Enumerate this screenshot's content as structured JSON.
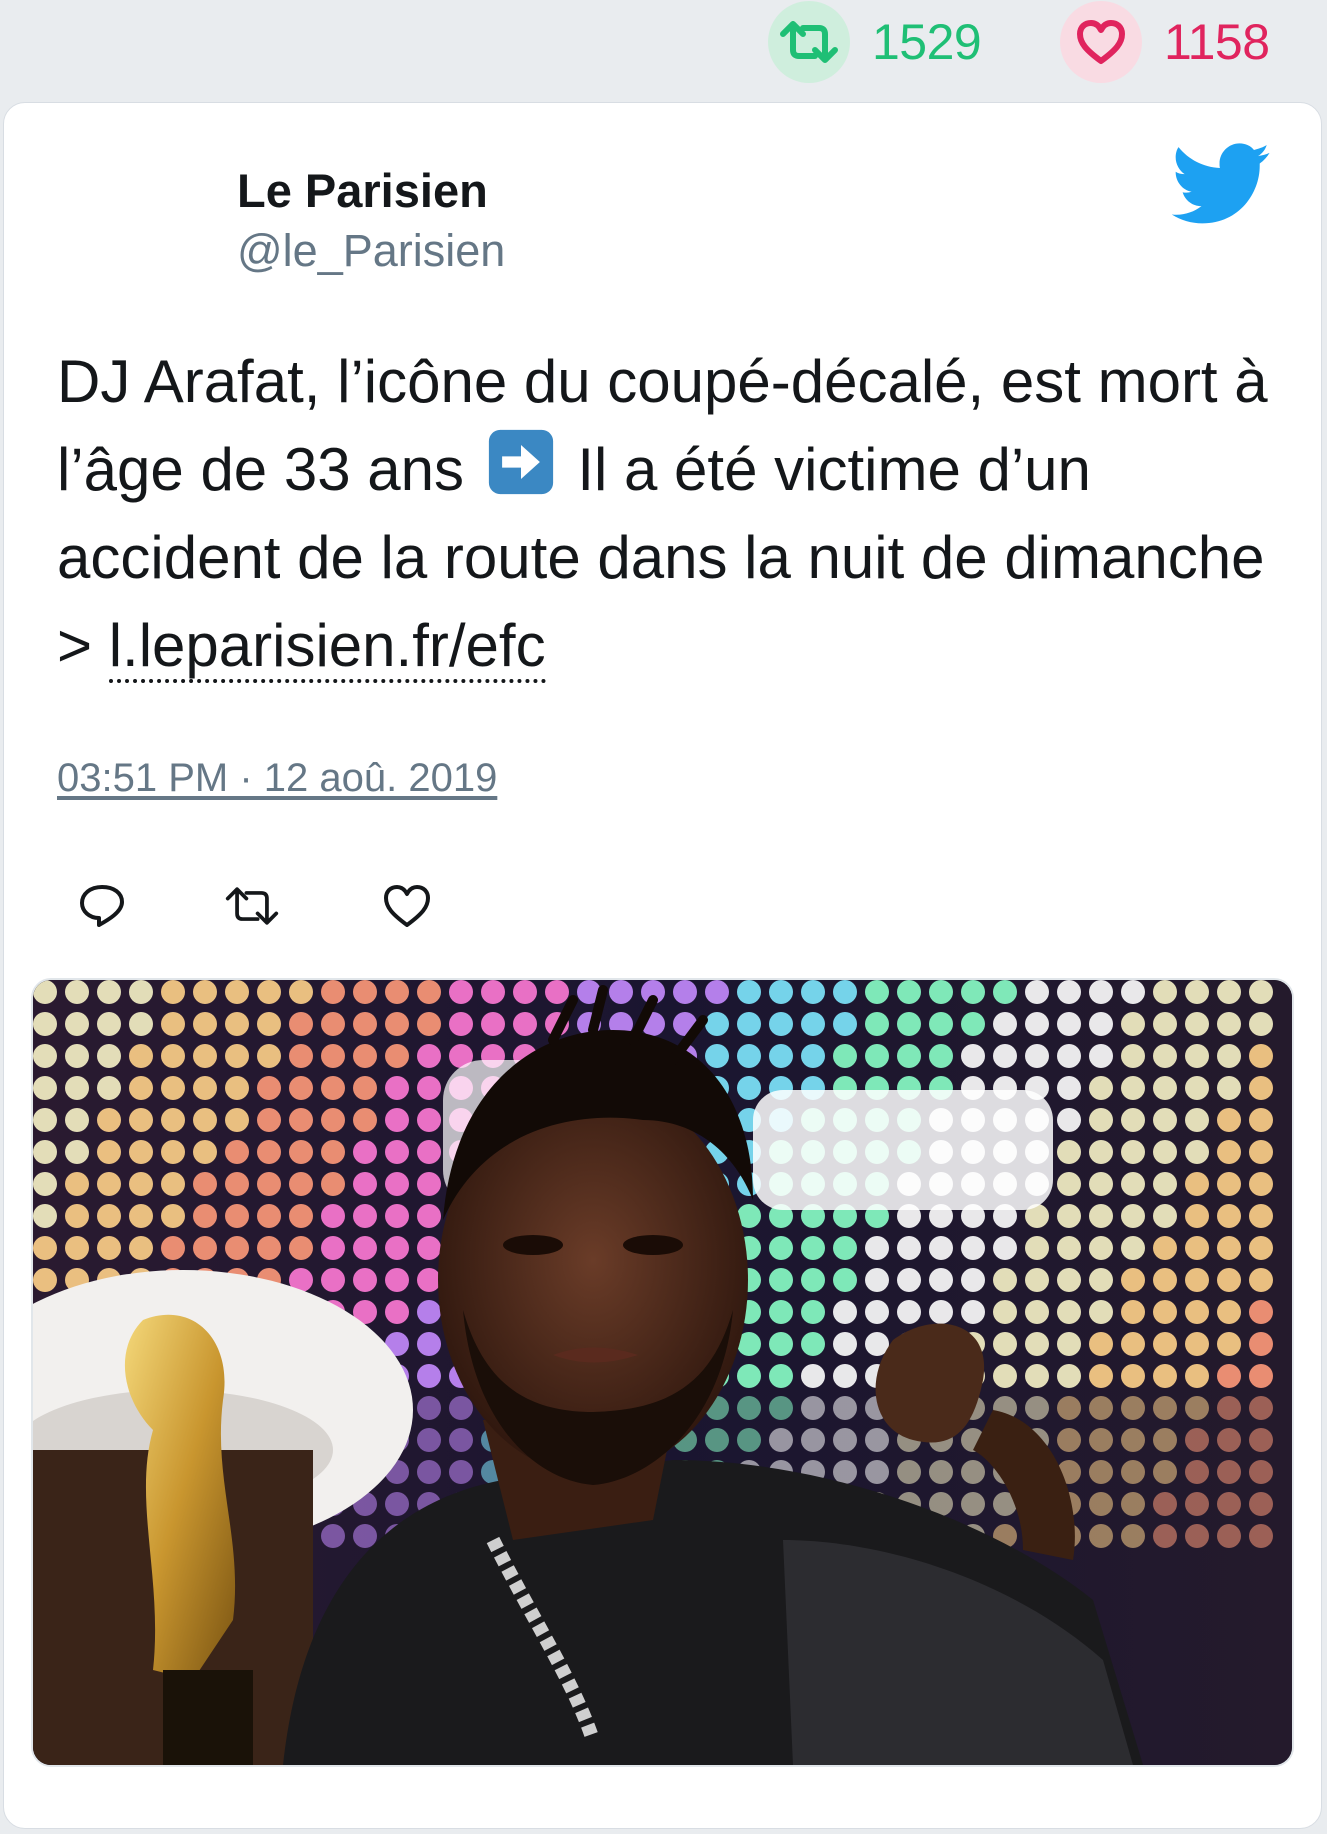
{
  "stats": {
    "retweets": "1529",
    "likes": "1158",
    "retweet_icon": "retweet-icon",
    "like_icon": "heart-icon"
  },
  "author": {
    "name": "Le Parisien",
    "handle": "@le_Parisien"
  },
  "tweet": {
    "text_part1": "DJ Arafat, l’icône du coupé-décalé, est mort à l’âge de 33 ans",
    "emoji": "right-arrow-emoji",
    "text_part2": "Il a été victime d’un accident de la route dans la nuit de dimanche >",
    "link": "l.leparisien.fr/efc"
  },
  "timestamp": "03:51 PM · 12 aoû. 2019",
  "actions": [
    "reply-icon",
    "retweet-icon",
    "like-icon"
  ],
  "media": {
    "type": "photo"
  },
  "colors": {
    "retweet": "#1fbf75",
    "like": "#e0245e",
    "twitter_blue": "#1da1f2",
    "handle_gray": "#657786"
  }
}
